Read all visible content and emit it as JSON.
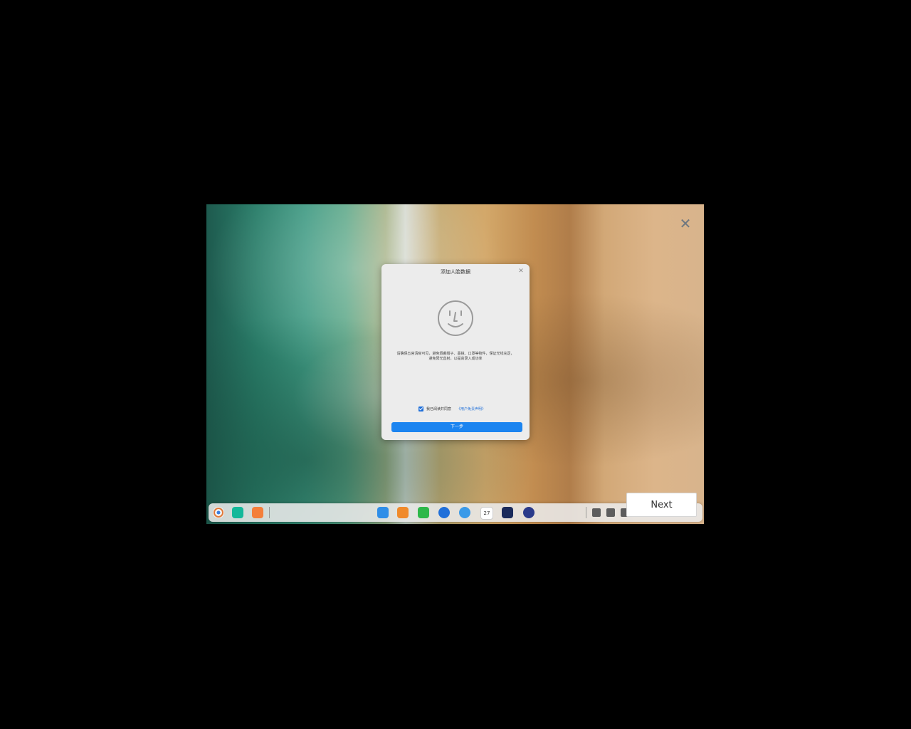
{
  "dialog": {
    "title": "添加人脸数据",
    "close_icon": "close-icon",
    "tip_line1": "请确保五官清晰可见，避免佩戴帽子、墨镜、口罩等物件，保证光线充足，",
    "tip_line2": "避免阳光直射，以提高录入成功率",
    "agree_label": "我已阅读并同意",
    "agree_link": "《用户免责声明》",
    "agree_checked": true,
    "next_step_label": "下一步"
  },
  "overlay": {
    "close_icon": "close-icon",
    "next_button_label": "Next"
  },
  "taskbar": {
    "calendar_day": "27"
  },
  "colors": {
    "accent": "#1b84f0",
    "dialog_bg": "#ececec"
  }
}
